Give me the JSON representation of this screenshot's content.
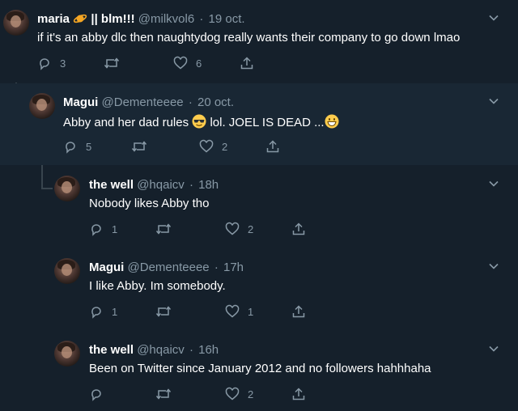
{
  "tweets": [
    {
      "name": "maria",
      "badge": "|| blm!!!",
      "handle": "@milkvol6",
      "time": "19 oct.",
      "text": "if it's an abby dlc then naughtydog really wants their company to go down lmao",
      "replies": "3",
      "retweets": "",
      "likes": "6"
    },
    {
      "name": "Magui",
      "handle": "@Dementeeee",
      "time": "20 oct.",
      "text_before": "Abby and her dad rules",
      "text_mid": " lol. JOEL IS DEAD ...",
      "replies": "5",
      "retweets": "",
      "likes": "2"
    },
    {
      "name": "the well",
      "handle": "@hqaicv",
      "time": "18h",
      "text": "Nobody likes Abby tho",
      "replies": "1",
      "retweets": "",
      "likes": "2"
    },
    {
      "name": "Magui",
      "handle": "@Dementeeee",
      "time": "17h",
      "text": "I like Abby. Im somebody.",
      "replies": "1",
      "retweets": "",
      "likes": "1"
    },
    {
      "name": "the well",
      "handle": "@hqaicv",
      "time": "16h",
      "text": "Been on Twitter since January 2012 and no followers hahhhaha",
      "replies": "",
      "retweets": "",
      "likes": "2"
    }
  ],
  "separator": "·",
  "colors": {
    "background": "#15202b",
    "nested_background": "#192734",
    "text": "#ffffff",
    "muted": "#8899a6",
    "thread_line": "#38444d"
  },
  "icons": [
    "reply-icon",
    "retweet-icon",
    "like-icon",
    "share-icon",
    "chevron-down-icon"
  ]
}
